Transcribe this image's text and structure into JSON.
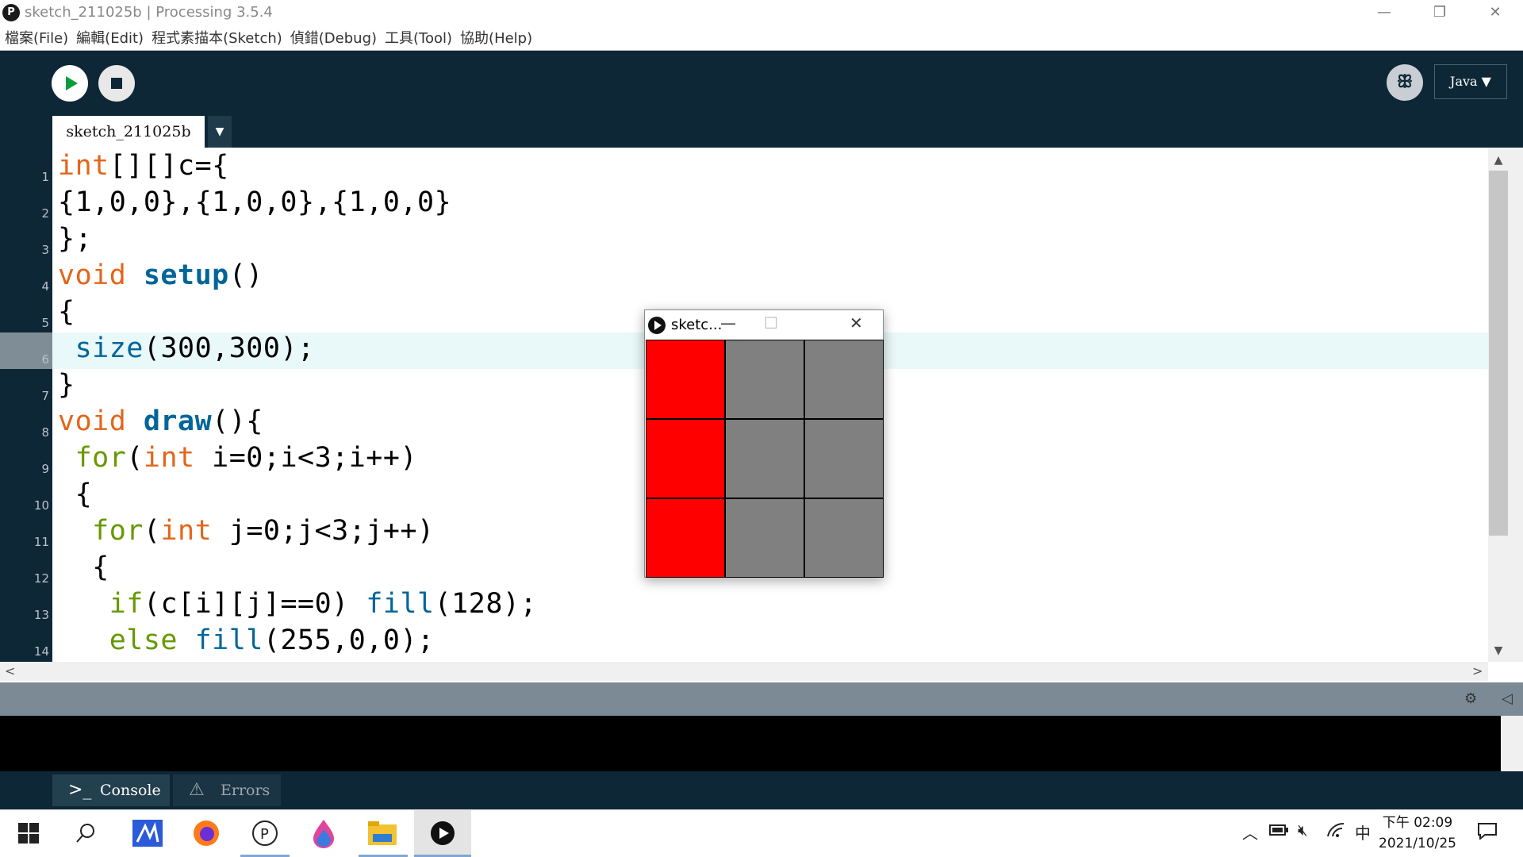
{
  "window": {
    "app_icon": "P",
    "title": "sketch_211025b | Processing 3.5.4",
    "minimize": "—",
    "restore": "❐",
    "close": "✕"
  },
  "menu": [
    "檔案(File)",
    "編輯(Edit)",
    "程式素描本(Sketch)",
    "偵錯(Debug)",
    "工具(Tool)",
    "協助(Help)"
  ],
  "toolbar": {
    "debug_label": "ꕥ",
    "mode_label": "Java ▼"
  },
  "tabs": {
    "active": "sketch_211025b",
    "menu_glyph": "▼"
  },
  "editor": {
    "line_numbers": [
      "1",
      "2",
      "3",
      "4",
      "5",
      "6",
      "7",
      "8",
      "9",
      "10",
      "11",
      "12",
      "13",
      "14"
    ],
    "lines": [
      [
        {
          "t": "int",
          "c": "kw"
        },
        {
          "t": "[][]c={",
          "c": ""
        }
      ],
      [
        {
          "t": "{1,0,0},{1,0,0},{1,0,0}",
          "c": ""
        }
      ],
      [
        {
          "t": "};",
          "c": ""
        }
      ],
      [
        {
          "t": "void ",
          "c": "kw"
        },
        {
          "t": "setup",
          "c": "fnb"
        },
        {
          "t": "()",
          "c": ""
        }
      ],
      [
        {
          "t": "{",
          "c": ""
        }
      ],
      [
        {
          "t": " ",
          "c": ""
        },
        {
          "t": "size",
          "c": "fn"
        },
        {
          "t": "(300,300);",
          "c": ""
        }
      ],
      [
        {
          "t": "}",
          "c": ""
        }
      ],
      [
        {
          "t": "void ",
          "c": "kw"
        },
        {
          "t": "draw",
          "c": "fnb"
        },
        {
          "t": "(){",
          "c": ""
        }
      ],
      [
        {
          "t": " ",
          "c": ""
        },
        {
          "t": "for",
          "c": "ctl"
        },
        {
          "t": "(",
          "c": ""
        },
        {
          "t": "int",
          "c": "kw"
        },
        {
          "t": " i=0;i<3;i++)",
          "c": ""
        }
      ],
      [
        {
          "t": " {",
          "c": ""
        }
      ],
      [
        {
          "t": "  ",
          "c": ""
        },
        {
          "t": "for",
          "c": "ctl"
        },
        {
          "t": "(",
          "c": ""
        },
        {
          "t": "int",
          "c": "kw"
        },
        {
          "t": " j=0;j<3;j++)",
          "c": ""
        }
      ],
      [
        {
          "t": "  {",
          "c": ""
        }
      ],
      [
        {
          "t": "   ",
          "c": ""
        },
        {
          "t": "if",
          "c": "ctl"
        },
        {
          "t": "(c[i][j]==0) ",
          "c": ""
        },
        {
          "t": "fill",
          "c": "fn"
        },
        {
          "t": "(128);",
          "c": ""
        }
      ],
      [
        {
          "t": "   ",
          "c": ""
        },
        {
          "t": "else ",
          "c": "ctl"
        },
        {
          "t": "fill",
          "c": "fn"
        },
        {
          "t": "(255,0,0);",
          "c": ""
        }
      ]
    ],
    "highlighted_line": 6
  },
  "console": {
    "tab_console": "Console",
    "tab_errors": "Errors",
    "console_icon": ">_",
    "errors_icon": "⚠"
  },
  "sketch_window": {
    "title": "sketc...",
    "minimize": "—",
    "maximize": "☐",
    "close": "✕",
    "grid": [
      [
        "#ff0000",
        "#808080",
        "#808080"
      ],
      [
        "#ff0000",
        "#808080",
        "#808080"
      ],
      [
        "#ff0000",
        "#808080",
        "#808080"
      ]
    ]
  },
  "taskbar": {
    "start_icon": "start-icon",
    "clock_line1": "下午 02:09",
    "clock_line2": "2021/10/25",
    "ime": "中"
  },
  "colors": {
    "editor_bg": "#0e2737",
    "keyword": "#e2661a",
    "function": "#006699",
    "control": "#669900",
    "run_green": "#0a9e3a"
  }
}
